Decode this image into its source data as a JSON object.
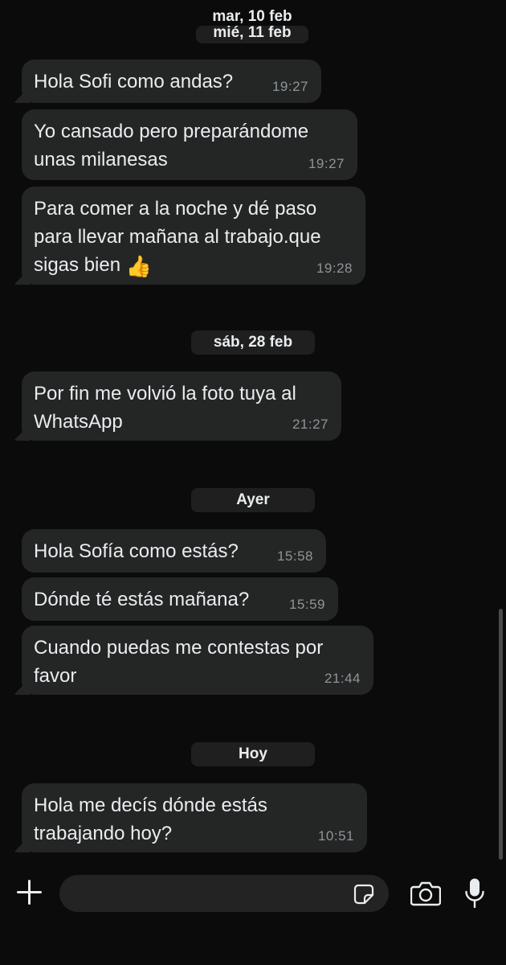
{
  "dates": {
    "d1": "mar, 10 feb",
    "d2": "mié, 11 feb",
    "d3": "sáb, 28 feb",
    "d4": "Ayer",
    "d5": "Hoy"
  },
  "messages": [
    {
      "text": "Hola Sofi como andas?",
      "time": "19:27"
    },
    {
      "text": "Yo cansado pero preparándome\nunas milanesas",
      "time": "19:27"
    },
    {
      "text": "Para comer a la noche y dé paso\npara llevar mañana al trabajo.que\nsigas bien",
      "emoji": "👍",
      "time": "19:28"
    },
    {
      "text": "Por fin me volvió la foto tuya al\nWhatsApp",
      "time": "21:27"
    },
    {
      "text": "Hola Sofía como estás?",
      "time": "15:58"
    },
    {
      "text": "Dónde té estás mañana?",
      "time": "15:59"
    },
    {
      "text": "Cuando puedas me contestas por\nfavor",
      "time": "21:44"
    },
    {
      "text": "Hola me decís dónde estás\ntrabajando hoy?",
      "time": "10:51"
    }
  ],
  "composer": {
    "value": "",
    "placeholder": ""
  },
  "icons": {
    "attach": "plus-icon",
    "sticker": "sticker-icon",
    "camera": "camera-icon",
    "mic": "microphone-icon"
  },
  "colors": {
    "background": "#0b0b0b",
    "bubble": "#242626",
    "date_pill": "#1f1f1f",
    "timestamp": "#8d9598",
    "text": "#e9edef"
  }
}
